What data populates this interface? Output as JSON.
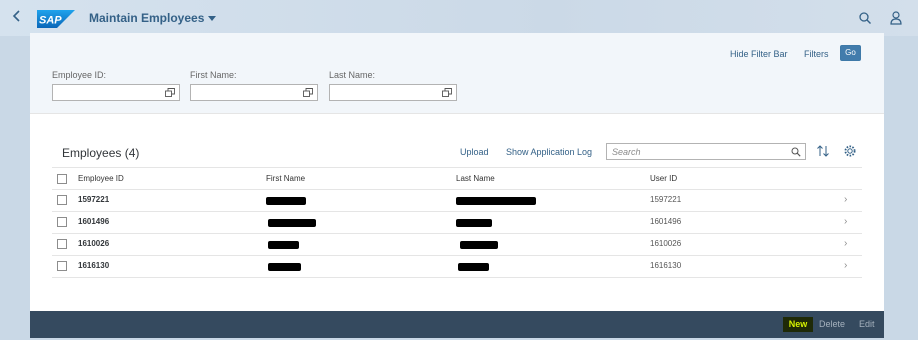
{
  "shell": {
    "logo_text": "SAP",
    "title": "Maintain Employees",
    "icons": [
      "back-icon",
      "search-icon",
      "user-icon"
    ]
  },
  "filterbar": {
    "hide_label": "Hide Filter Bar",
    "filters_label": "Filters",
    "go_label": "Go",
    "fields": [
      {
        "label": "Employee ID:",
        "value": ""
      },
      {
        "label": "First Name:",
        "value": ""
      },
      {
        "label": "Last Name:",
        "value": ""
      }
    ]
  },
  "table": {
    "title": "Employees (4)",
    "upload_label": "Upload",
    "log_label": "Show Application Log",
    "search_placeholder": "Search",
    "columns": [
      "Employee ID",
      "First Name",
      "Last Name",
      "User ID"
    ],
    "rows": [
      {
        "employee_id": "1597221",
        "user_id": "1597221"
      },
      {
        "employee_id": "1601496",
        "user_id": "1601496"
      },
      {
        "employee_id": "1610026",
        "user_id": "1610026"
      },
      {
        "employee_id": "1616130",
        "user_id": "1616130"
      }
    ]
  },
  "footer": {
    "new_label": "New",
    "delete_label": "Delete",
    "edit_label": "Edit"
  },
  "colors": {
    "brand": "#346187",
    "go_button": "#427cac",
    "footer_bg": "#354a5f",
    "new_highlight": "#d6f200"
  }
}
